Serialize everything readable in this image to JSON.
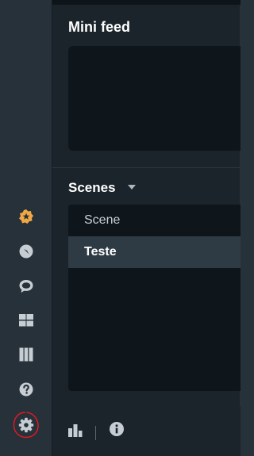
{
  "mini_feed": {
    "title": "Mini feed"
  },
  "scenes": {
    "title": "Scenes",
    "items": [
      {
        "label": "Scene",
        "active": false
      },
      {
        "label": "Teste",
        "active": true
      }
    ]
  },
  "sidebar": {
    "icons": [
      "star-badge-icon",
      "compass-icon",
      "chat-bubble-icon",
      "grid-icon",
      "columns-icon",
      "help-icon",
      "gear-icon"
    ],
    "annotation_color": "#e8181f"
  },
  "bottom_bar": {
    "icons": [
      "bar-chart-icon",
      "info-icon"
    ]
  },
  "colors": {
    "sidebar_bg": "#27313a",
    "main_bg": "#1b242b",
    "panel_bg": "#0e161c",
    "active_row": "#2e3a44",
    "accent_orange": "#f0a844",
    "icon_gray": "#c6cdd3"
  }
}
